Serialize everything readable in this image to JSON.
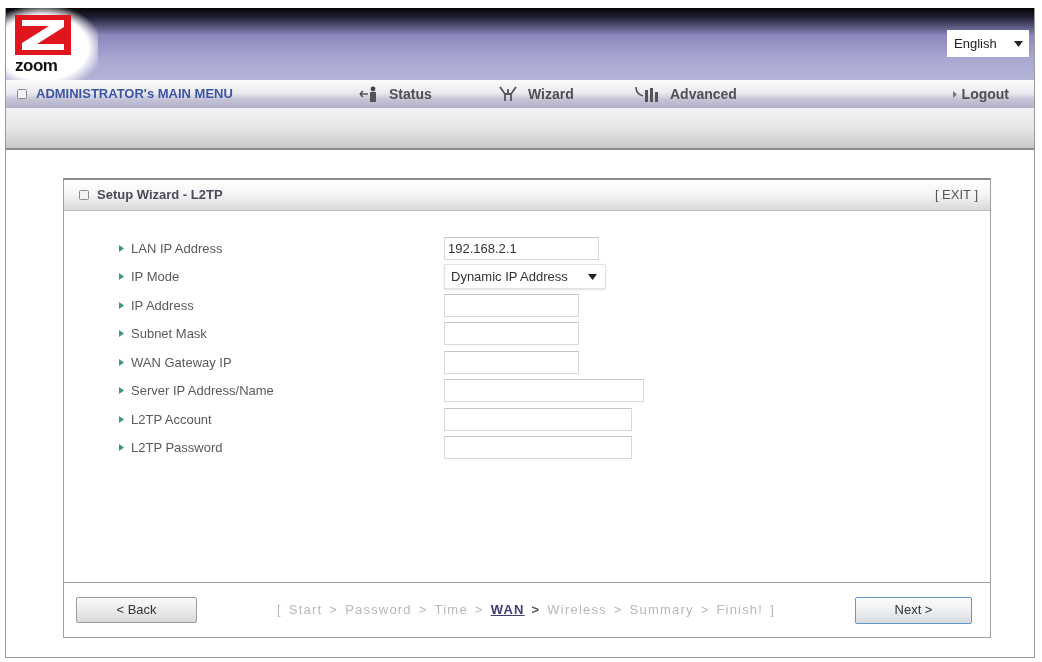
{
  "header": {
    "logo_text": "zoom",
    "language": {
      "value": "English"
    }
  },
  "nav": {
    "title": "ADMINISTRATOR's MAIN MENU",
    "items": [
      {
        "label": "Status",
        "kind": "status"
      },
      {
        "label": "Wizard",
        "kind": "wizard"
      },
      {
        "label": "Advanced",
        "kind": "advanced"
      }
    ],
    "logout": "Logout"
  },
  "panel": {
    "title": "Setup Wizard - L2TP",
    "exit": "[ EXIT ]",
    "fields": [
      {
        "label": "LAN IP Address",
        "kind": "text",
        "value": "192.168.2.1"
      },
      {
        "label": "IP Mode",
        "kind": "select",
        "value": "Dynamic IP Address"
      },
      {
        "label": "IP Address",
        "kind": "text"
      },
      {
        "label": "Subnet Mask",
        "kind": "text"
      },
      {
        "label": "WAN Gateway IP",
        "kind": "text"
      },
      {
        "label": "Server IP Address/Name",
        "kind": "text"
      },
      {
        "label": "L2TP Account",
        "kind": "text"
      },
      {
        "label": "L2TP Password",
        "kind": "text"
      }
    ],
    "footer": {
      "back": "< Back",
      "next": "Next >",
      "breadcrumb": {
        "open": "[",
        "steps": [
          {
            "label": "Start",
            "selected": false
          },
          {
            "label": "Password",
            "selected": false
          },
          {
            "label": "Time",
            "selected": false
          },
          {
            "label": "WAN",
            "selected": true
          },
          {
            "label": "Wireless",
            "selected": false
          },
          {
            "label": "Summary",
            "selected": false
          },
          {
            "label": "Finish!",
            "selected": false
          }
        ],
        "separators": [
          ">",
          ">",
          ">",
          ">",
          ">",
          ">"
        ],
        "close": "]"
      }
    }
  }
}
